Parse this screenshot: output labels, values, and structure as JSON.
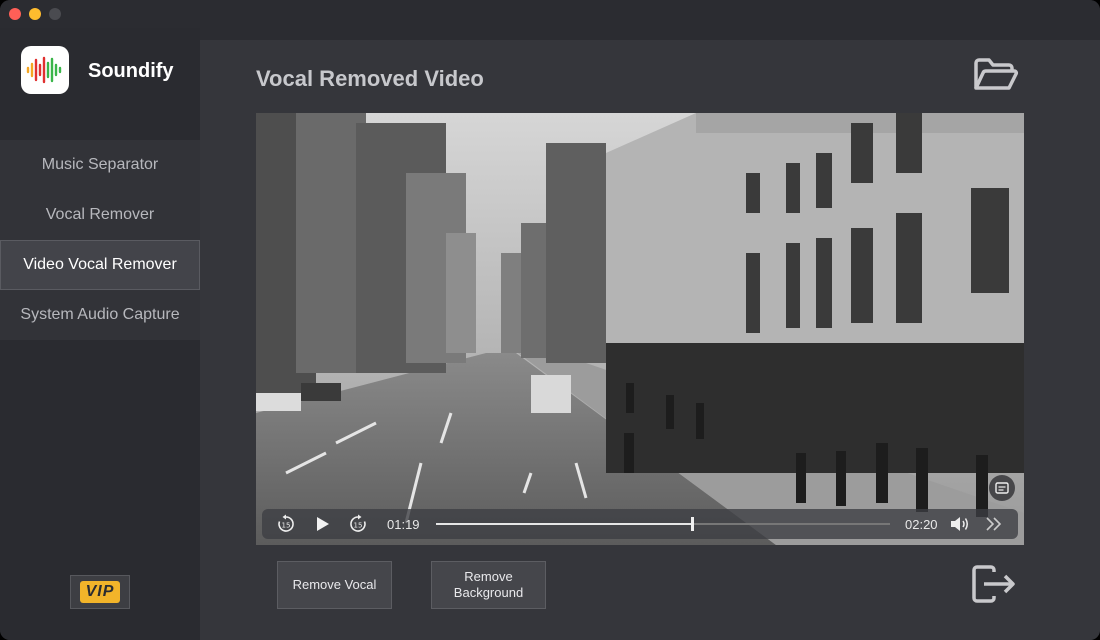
{
  "app": {
    "name": "Soundify"
  },
  "sidebar": {
    "items": [
      {
        "label": "Music Separator",
        "active": false
      },
      {
        "label": "Vocal Remover",
        "active": false
      },
      {
        "label": "Video Vocal Remover",
        "active": true
      },
      {
        "label": "System Audio Capture",
        "active": false
      }
    ],
    "vip_label": "VIP"
  },
  "main": {
    "title": "Vocal Removed Video",
    "open_icon": "folder-open-icon",
    "export_icon": "export-icon"
  },
  "player": {
    "current_time": "01:19",
    "duration": "02:20",
    "progress": 0.564,
    "rewind_icon": "rewind-15-icon",
    "play_icon": "play-icon",
    "forward_icon": "forward-15-icon",
    "volume_icon": "volume-icon",
    "speed_icon": "fast-forward-icon",
    "caption_icon": "subtitles-icon"
  },
  "actions": {
    "remove_vocal": "Remove Vocal",
    "remove_background": "Remove Background"
  },
  "colors": {
    "accent_vip": "#f2b42a",
    "sidebar_bg": "#2a2b30",
    "main_bg": "#35363b",
    "active_item_bg": "#43444a"
  }
}
